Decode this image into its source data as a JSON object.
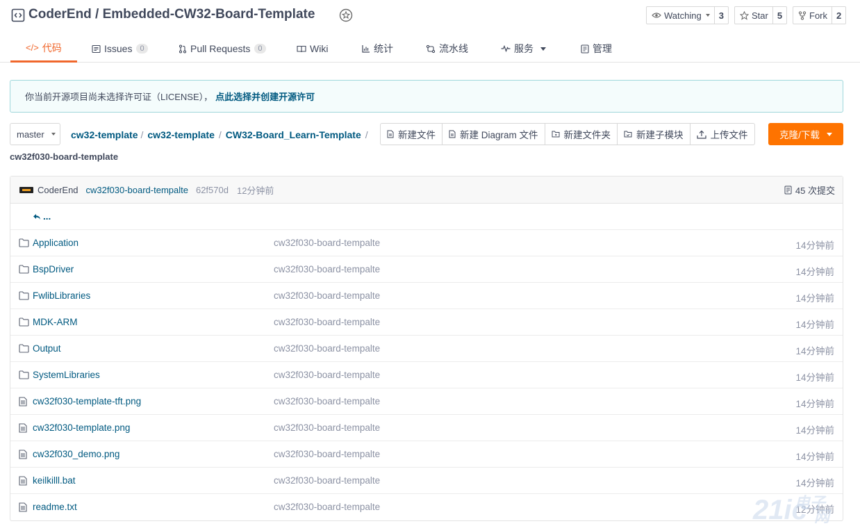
{
  "header": {
    "repo_title": "CoderEnd / Embedded-CW32-Board-Template",
    "watching": {
      "label": "Watching",
      "count": "3"
    },
    "star": {
      "label": "Star",
      "count": "5"
    },
    "fork": {
      "label": "Fork",
      "count": "2"
    }
  },
  "tabs": [
    {
      "label": "代码",
      "icon": "code-icon",
      "active": true
    },
    {
      "label": "Issues",
      "count": "0",
      "icon": "issues-icon"
    },
    {
      "label": "Pull Requests",
      "count": "0",
      "icon": "pull-request-icon"
    },
    {
      "label": "Wiki",
      "icon": "book-icon"
    },
    {
      "label": "统计",
      "icon": "bar-chart-icon"
    },
    {
      "label": "流水线",
      "icon": "pipeline-icon"
    },
    {
      "label": "服务",
      "icon": "pulse-icon"
    },
    {
      "label": "管理",
      "icon": "settings-icon"
    }
  ],
  "notice": {
    "text": "你当前开源项目尚未选择许可证（LICENSE），",
    "link": "点此选择并创建开源许可"
  },
  "toolbar": {
    "branch": "master",
    "breadcrumb": [
      "cw32-template",
      "cw32-template",
      "CW32-Board_Learn-Template"
    ],
    "current_dir": "cw32f030-board-template",
    "actions": [
      "新建文件",
      "新建 Diagram 文件",
      "新建文件夹",
      "新建子模块",
      "上传文件"
    ],
    "clone_label": "克隆/下载"
  },
  "commit": {
    "author": "CoderEnd",
    "message": "cw32f030-board-tempalte",
    "sha": "62f570d",
    "time": "12分钟前",
    "count_label": "45 次提交"
  },
  "up_label": "...",
  "files": [
    {
      "name": "Application",
      "type": "folder",
      "message": "cw32f030-board-tempalte",
      "time": "14分钟前"
    },
    {
      "name": "BspDriver",
      "type": "folder",
      "message": "cw32f030-board-tempalte",
      "time": "14分钟前"
    },
    {
      "name": "FwlibLibraries",
      "type": "folder",
      "message": "cw32f030-board-tempalte",
      "time": "14分钟前"
    },
    {
      "name": "MDK-ARM",
      "type": "folder",
      "message": "cw32f030-board-tempalte",
      "time": "14分钟前"
    },
    {
      "name": "Output",
      "type": "folder",
      "message": "cw32f030-board-tempalte",
      "time": "14分钟前"
    },
    {
      "name": "SystemLibraries",
      "type": "folder",
      "message": "cw32f030-board-tempalte",
      "time": "14分钟前"
    },
    {
      "name": "cw32f030-template-tft.png",
      "type": "file",
      "message": "cw32f030-board-tempalte",
      "time": "14分钟前"
    },
    {
      "name": "cw32f030-template.png",
      "type": "file",
      "message": "cw32f030-board-tempalte",
      "time": "14分钟前"
    },
    {
      "name": "cw32f030_demo.png",
      "type": "file",
      "message": "cw32f030-board-tempalte",
      "time": "14分钟前"
    },
    {
      "name": "keilkilll.bat",
      "type": "file",
      "message": "cw32f030-board-tempalte",
      "time": "14分钟前"
    },
    {
      "name": "readme.txt",
      "type": "file",
      "message": "cw32f030-board-tempalte",
      "time": "12分钟前"
    }
  ],
  "watermark": {
    "main": "21ic",
    "sub1": "电子",
    "sub2": "网"
  },
  "colors": {
    "accent": "#f0672c",
    "link": "#005980",
    "clone_button": "#fe7300",
    "muted": "#8c92a4"
  }
}
